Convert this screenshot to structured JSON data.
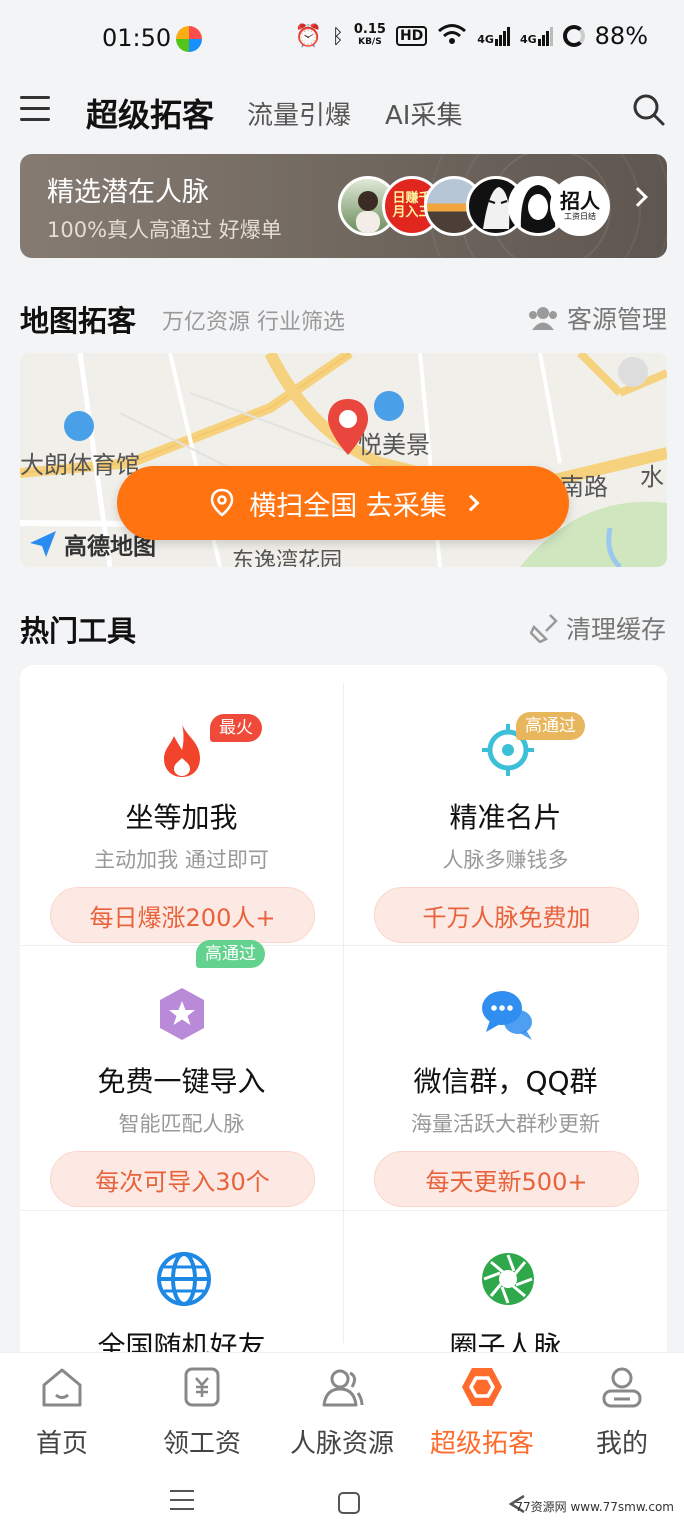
{
  "status_bar": {
    "time": "01:50",
    "speed_top": "0.15",
    "speed_bottom": "KB/S",
    "hd": "HD",
    "net1": "4G",
    "net2": "4G",
    "battery": "88%"
  },
  "nav": {
    "title": "超级拓客",
    "tab2": "流量引爆",
    "tab3": "AI采集"
  },
  "banner": {
    "title": "精选潜在人脉",
    "subtitle": "100%真人高通过 好爆单",
    "avatar2_text": "日赚千\n月入三",
    "avatar6_text": "招人",
    "avatar6_sub": "工资日结"
  },
  "map_section": {
    "title": "地图拓客",
    "subtitle": "万亿资源 行业筛选",
    "manage": "客源管理"
  },
  "map": {
    "place1": "大朗体育馆",
    "place2": "悦美景",
    "place3": "南路",
    "place4": "水",
    "place5": "东逸湾花园",
    "brand": "高德地图",
    "button": "横扫全国 去采集"
  },
  "tools_section": {
    "title": "热门工具",
    "clear": "清理缓存"
  },
  "tools": [
    {
      "name": "坐等加我",
      "desc": "主动加我 通过即可",
      "pill": "每日爆涨200人+",
      "badge": "最火"
    },
    {
      "name": "精准名片",
      "desc": "人脉多赚钱多",
      "pill": "千万人脉免费加",
      "badge": "高通过"
    },
    {
      "name": "免费一键导入",
      "desc": "智能匹配人脉",
      "pill": "每次可导入30个",
      "badge": "高通过"
    },
    {
      "name": "微信群，QQ群",
      "desc": "海量活跃大群秒更新",
      "pill": "每天更新500+",
      "badge": ""
    },
    {
      "name": "全国随机好友",
      "desc": "",
      "pill": "",
      "badge": ""
    },
    {
      "name": "圈子人脉",
      "desc": "",
      "pill": "",
      "badge": ""
    }
  ],
  "bottom_nav": [
    {
      "label": "首页",
      "icon": "home-icon"
    },
    {
      "label": "领工资",
      "icon": "wallet-icon"
    },
    {
      "label": "人脉资源",
      "icon": "contacts-icon"
    },
    {
      "label": "超级拓客",
      "icon": "hexagon-icon",
      "active": true
    },
    {
      "label": "我的",
      "icon": "profile-icon"
    }
  ],
  "watermark": "77资源网 www.77smw.com",
  "colors": {
    "accent": "#ff7310",
    "active_tab": "#ff6b2c",
    "pill_text": "#e8623c",
    "badge_red": "#f04a3a",
    "badge_gold": "#e8b65c",
    "badge_green": "#64d28f"
  }
}
